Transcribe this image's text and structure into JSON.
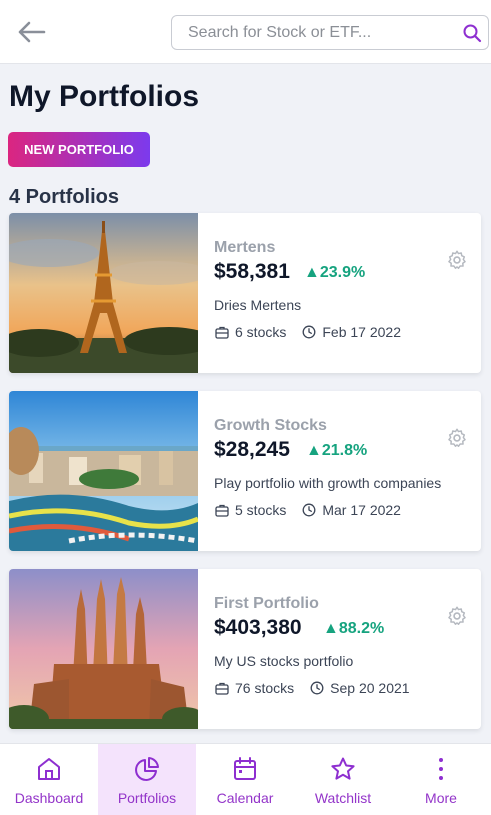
{
  "header": {
    "back_icon": "arrow-left-icon",
    "search_placeholder": "Search for Stock or ETF...",
    "search_icon": "search-icon"
  },
  "page": {
    "title": "My Portfolios",
    "new_button": "NEW PORTFOLIO",
    "count_label": "4 Portfolios"
  },
  "portfolios": [
    {
      "name": "Mertens",
      "value": "$58,381",
      "change": "▲23.9%",
      "description": "Dries Mertens",
      "stocks": "6 stocks",
      "date": "Feb 17 2022",
      "image": "eiffel-tower-photo"
    },
    {
      "name": "Growth Stocks",
      "value": "$28,245",
      "change": "▲21.8%",
      "description": "Play portfolio with growth companies",
      "stocks": "5 stocks",
      "date": "Mar 17 2022",
      "image": "park-guell-photo"
    },
    {
      "name": "First Portfolio",
      "value": "$403,380",
      "change": "▲88.2%",
      "description": "My US stocks portfolio",
      "stocks": "76 stocks",
      "date": "Sep 20 2021",
      "image": "sagrada-familia-photo"
    }
  ],
  "nav": [
    {
      "label": "Dashboard",
      "icon": "home-icon"
    },
    {
      "label": "Portfolios",
      "icon": "pie-chart-icon",
      "active": true
    },
    {
      "label": "Calendar",
      "icon": "calendar-icon"
    },
    {
      "label": "Watchlist",
      "icon": "star-icon"
    },
    {
      "label": "More",
      "icon": "more-vertical-icon"
    }
  ],
  "colors": {
    "accent": "#9334c9",
    "gain": "#16a37f",
    "button_gradient_start": "#db2680",
    "button_gradient_end": "#7c3aed",
    "background": "#f0f2f7"
  }
}
